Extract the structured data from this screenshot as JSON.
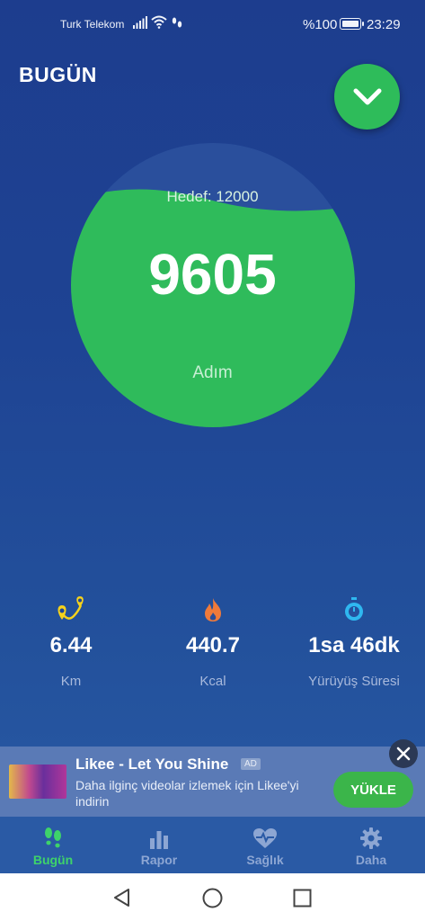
{
  "status_bar": {
    "carrier": "Turk Telekom",
    "battery_text": "%100",
    "time": "23:29"
  },
  "header": {
    "title": "BUGÜN",
    "expand_icon": "chevron-down-icon"
  },
  "steps": {
    "goal_label": "Hedef: 12000",
    "count": "9605",
    "unit": "Adım",
    "progress_fraction": 0.8
  },
  "stats": [
    {
      "icon": "route-pin-icon",
      "value": "6.44",
      "label": "Km",
      "color": "#f5d21c"
    },
    {
      "icon": "flame-icon",
      "value": "440.7",
      "label": "Kcal",
      "color": "#f07a3a"
    },
    {
      "icon": "stopwatch-icon",
      "value": "1sa 46dk",
      "label": "Yürüyüş Süresi",
      "color": "#2fb8f0"
    }
  ],
  "ad": {
    "title": "Likee - Let You Shine",
    "badge": "AD",
    "description": "Daha ilginç videolar izlemek için Likee'yi indirin",
    "cta": "YÜKLE"
  },
  "tabs": [
    {
      "label": "Bugün",
      "icon": "footsteps-icon",
      "active": true
    },
    {
      "label": "Rapor",
      "icon": "bar-chart-icon",
      "active": false
    },
    {
      "label": "Sağlık",
      "icon": "heart-pulse-icon",
      "active": false
    },
    {
      "label": "Daha",
      "icon": "gear-icon",
      "active": false
    }
  ],
  "colors": {
    "accent": "#2ebc5a",
    "active_tab": "#3ed36a",
    "inactive_tab": "#8da6d3"
  }
}
